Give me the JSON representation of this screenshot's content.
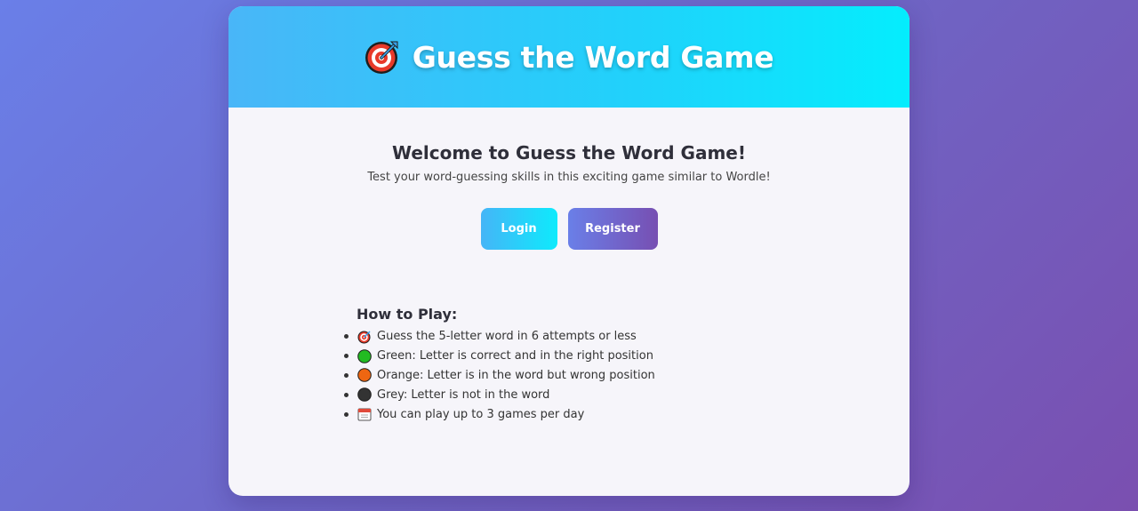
{
  "header": {
    "icon": "target-icon",
    "title": "Guess the Word Game"
  },
  "welcome": {
    "heading": "Welcome to Guess the Word Game!",
    "subtitle": "Test your word-guessing skills in this exciting game similar to Wordle!"
  },
  "buttons": {
    "login_label": "Login",
    "register_label": "Register"
  },
  "how_to_play": {
    "heading": "How to Play:",
    "items": [
      {
        "icon": "target-icon",
        "text": "Guess the 5-letter word in 6 attempts or less"
      },
      {
        "icon": "green-circle-icon",
        "color": "#22bb22",
        "text": "Green: Letter is correct and in the right position"
      },
      {
        "icon": "orange-circle-icon",
        "color": "#ee6611",
        "text": "Orange: Letter is in the word but wrong position"
      },
      {
        "icon": "grey-circle-icon",
        "color": "#333333",
        "text": "Grey: Letter is not in the word"
      },
      {
        "icon": "calendar-icon",
        "text": "You can play up to 3 games per day"
      }
    ]
  },
  "colors": {
    "background_start": "#6a7fe8",
    "background_end": "#7a4fb0",
    "header_start": "#49b6f8",
    "header_end": "#04edfd"
  }
}
